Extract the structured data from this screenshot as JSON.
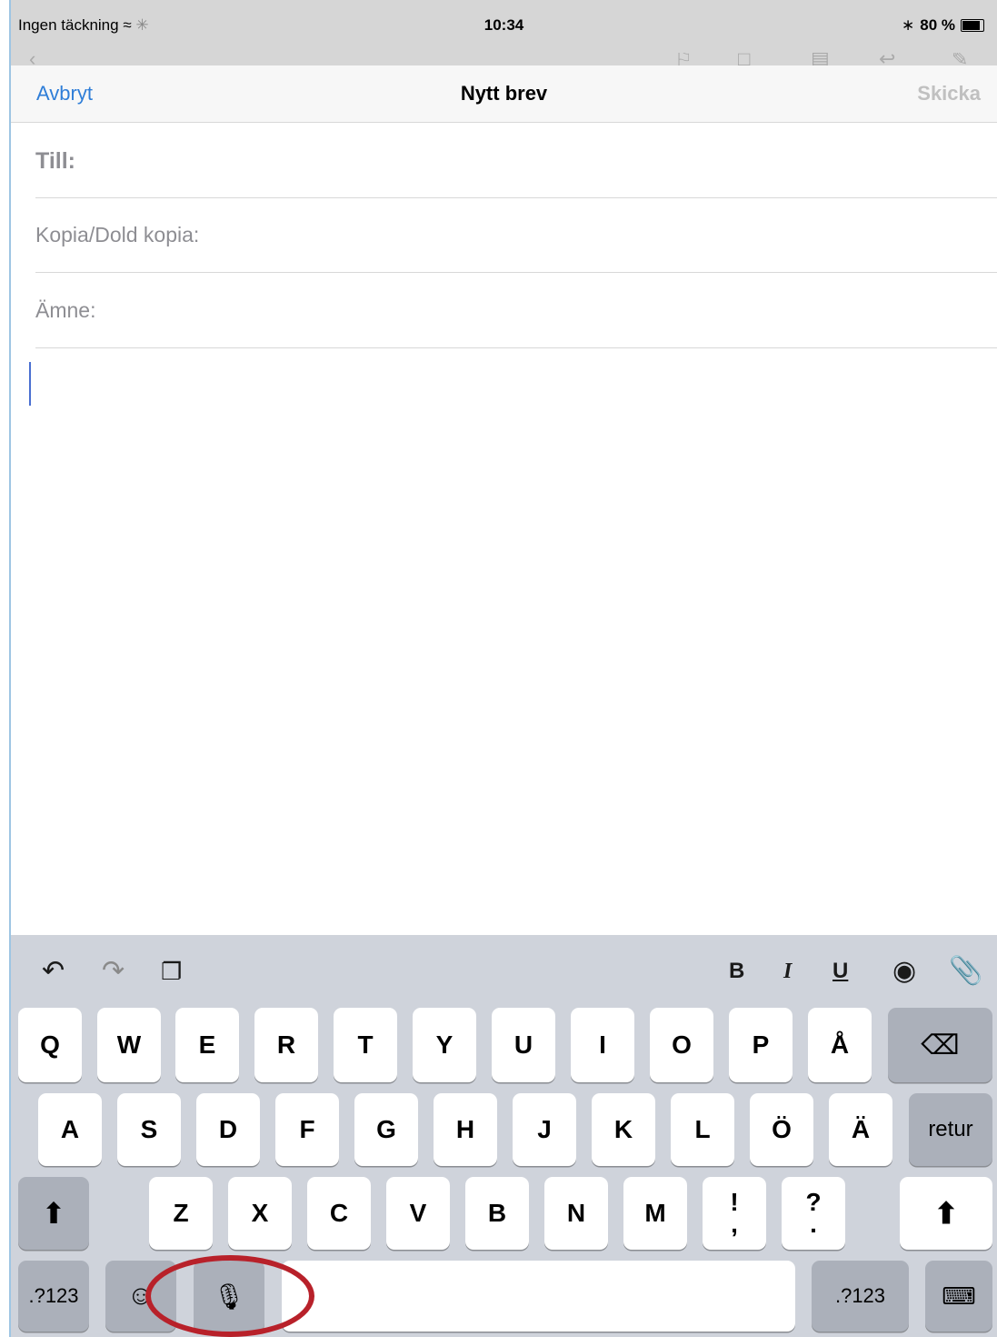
{
  "status_bar": {
    "carrier": "Ingen täckning",
    "time": "10:34",
    "battery": "80 %"
  },
  "nav": {
    "cancel": "Avbryt",
    "title": "Nytt brev",
    "send": "Skicka"
  },
  "fields": {
    "to": "Till:",
    "cc": "Kopia/Dold kopia:",
    "subject": "Ämne:"
  },
  "toolbar": {
    "bold": "B",
    "italic": "I",
    "underline": "U"
  },
  "keys": {
    "row1": [
      "Q",
      "W",
      "E",
      "R",
      "T",
      "Y",
      "U",
      "I",
      "O",
      "P",
      "Å"
    ],
    "row2": [
      "A",
      "S",
      "D",
      "F",
      "G",
      "H",
      "J",
      "K",
      "L",
      "Ö",
      "Ä"
    ],
    "row3": [
      "Z",
      "X",
      "C",
      "V",
      "B",
      "N",
      "M"
    ],
    "punct1": {
      "top": "!",
      "bottom": ","
    },
    "punct2": {
      "top": "?",
      "bottom": "."
    },
    "return": "retur",
    "numbers": ".?123"
  },
  "icons": [
    "wifi-icon",
    "bluetooth-icon",
    "battery-icon",
    "undo-icon",
    "redo-icon",
    "paste-icon",
    "camera-icon",
    "paperclip-icon",
    "backspace-icon",
    "shift-icon",
    "emoji-icon",
    "microphone-icon",
    "hide-keyboard-icon"
  ],
  "annotation_color": "#b8212a"
}
